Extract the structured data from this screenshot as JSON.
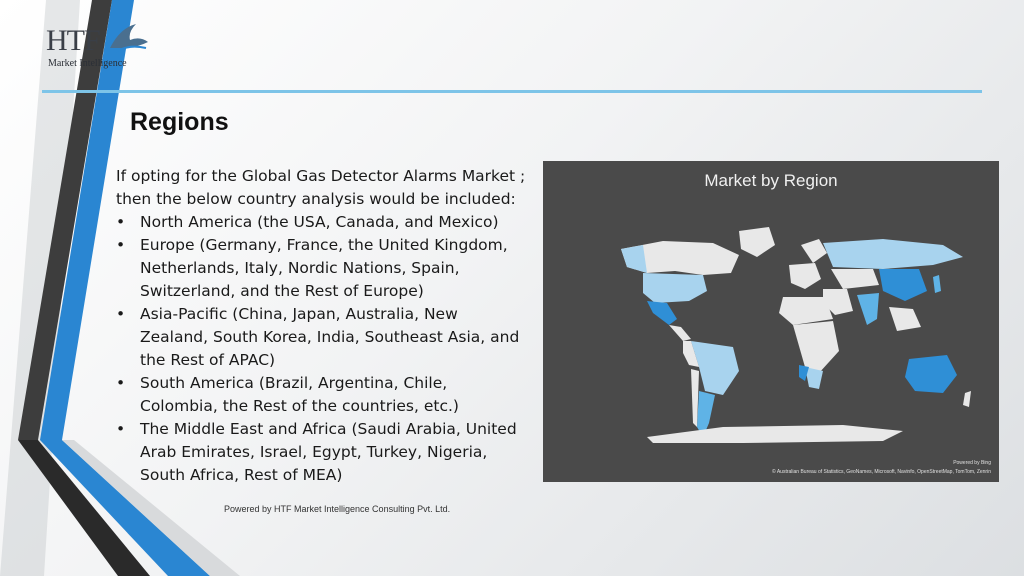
{
  "logo": {
    "main": "HTF",
    "sub": "Market Intelligence"
  },
  "title": "Regions",
  "intro": "If opting for the Global Gas Detector Alarms Market ; then the below country analysis would be included:",
  "bullet_symbol": "•",
  "regions": [
    "North America (the USA, Canada, and Mexico)",
    "Europe (Germany, France, the United Kingdom, Netherlands, Italy, Nordic Nations, Spain, Switzerland, and the Rest of Europe)",
    "Asia-Pacific (China, Japan, Australia, New Zealand, South Korea, India, Southeast Asia, and the Rest of APAC)",
    "South America (Brazil, Argentina, Chile, Colombia, the Rest of the countries, etc.)",
    "The Middle East and Africa (Saudi Arabia, United Arab Emirates, Israel, Egypt, Turkey, Nigeria, South Africa, Rest of MEA)"
  ],
  "footer": "Powered by HTF Market Intelligence Consulting Pvt. Ltd.",
  "map": {
    "title": "Market by Region",
    "powered_by": "Powered by Bing",
    "credits": "© Australian Bureau of Statistics, GeoNames, Microsoft, Navinfo, OpenStreetMap, TomTom, Zenrin",
    "colors": {
      "panel": "#4a4a4a",
      "land": "#e8e8e8",
      "light": "#a8d3ee",
      "medium": "#5fb3e6",
      "dark": "#2f8fd6"
    }
  },
  "colors": {
    "accent_rule": "#7dc4e8",
    "stripe_dark": "#3d3d3d",
    "stripe_blue": "#2a86d2"
  }
}
